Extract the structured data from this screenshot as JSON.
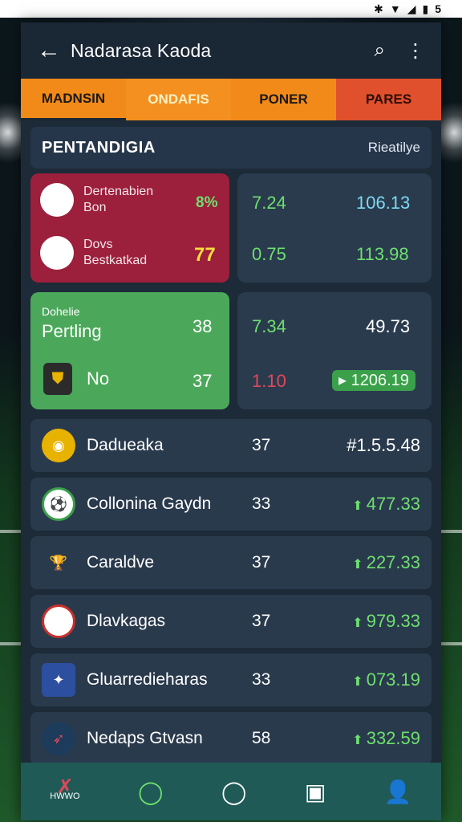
{
  "status_bar": {
    "icons": [
      "bluetooth-icon",
      "wifi-icon",
      "signal-icon",
      "battery-icon"
    ],
    "text": "5"
  },
  "app_bar": {
    "title": "Nadarasa Kaoda"
  },
  "tabs": [
    "MADNSIN",
    "ONDAFIS",
    "PONER",
    "PARES"
  ],
  "section": {
    "heading": "PENTANDIGIA",
    "right": "Rieatilye"
  },
  "cards": {
    "top_left": {
      "team1": {
        "name_line1": "Dertenabien",
        "name_line2": "Bon",
        "pct": "8%"
      },
      "team2": {
        "name_line1": "Dovs",
        "name_line2": "Bestkatkad",
        "pct": "77"
      }
    },
    "top_right": {
      "a": "7.24",
      "b": "106.13",
      "c": "0.75",
      "d": "113.98"
    },
    "green": {
      "small": "Dohelie",
      "big": "Pertling",
      "val1": "38",
      "team": "No",
      "val2": "37"
    },
    "bottom_right": {
      "a": "7.34",
      "b": "49.73",
      "c": "1.10",
      "d": "1206.19"
    }
  },
  "list": [
    {
      "name": "Dadueaka",
      "mid": "37",
      "value": "#1.5.5.48"
    },
    {
      "name": "Collonina Gaydn",
      "mid": "33",
      "value": "477.33"
    },
    {
      "name": "Caraldve",
      "mid": "37",
      "value": "227.33"
    },
    {
      "name": "Dlavkagas",
      "mid": "37",
      "value": "979.33"
    },
    {
      "name": "Gluarredieharas",
      "mid": "33",
      "value": "073.19"
    },
    {
      "name": "Nedaps Gtvasn",
      "mid": "58",
      "value": "332.59"
    }
  ],
  "bottom_nav": {
    "brand": "HWWO"
  }
}
